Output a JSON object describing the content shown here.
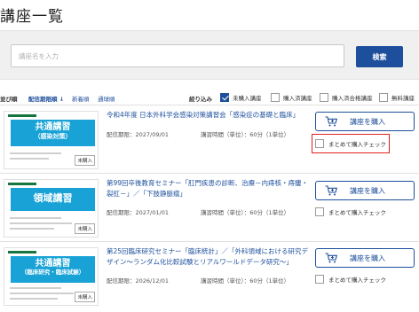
{
  "page": {
    "title": "講座一覧"
  },
  "search": {
    "placeholder": "講座名を入力",
    "value": "",
    "button_label": "検索"
  },
  "sort": {
    "label": "並び順",
    "options": [
      {
        "label": "配信期限順 ↓",
        "active": true
      },
      {
        "label": "新着順",
        "active": false
      },
      {
        "label": "通球順",
        "active": false
      }
    ]
  },
  "filter": {
    "label": "絞り込み",
    "options": [
      {
        "label": "未購入講座",
        "checked": true
      },
      {
        "label": "購入済講座",
        "checked": false
      },
      {
        "label": "購入済合格講座",
        "checked": false
      },
      {
        "label": "無料講座",
        "checked": false
      }
    ]
  },
  "courses": [
    {
      "title": "令和4年度 日本外科学会感染対策講習会「感染症の基礎と臨床」",
      "deadline": "配信期限：2027/09/01",
      "hours": "講習時間（単位）：60分（1単位）",
      "buy_label": "講座を購入",
      "bulk_label": "まとめて購入チェック",
      "thumb": {
        "line1": "共通講習",
        "line2": "（感染対策）",
        "badge": "未購入"
      }
    },
    {
      "title": "第99回卒後教育セミナー「肛門疾患の診断、治療－内痔核・痔瘻・裂肛－」／「下肢静脈瘤」",
      "deadline": "配信期限：2027/01/01",
      "hours": "講習時間（単位）：60分（1単位）",
      "buy_label": "講座を購入",
      "bulk_label": "まとめて購入チェック",
      "thumb": {
        "line1": "領域講習",
        "line2": "",
        "badge": "未購入"
      }
    },
    {
      "title": "第25回臨床研究セミナー「臨床統計」／「外科領域における研究デザイン～ランダム化比較試験とリアルワールドデータ研究～」",
      "deadline": "配信期限：2026/12/01",
      "hours": "講習時間（単位）：60分（1単位）",
      "buy_label": "講座を購入",
      "bulk_label": "まとめて購入チェック",
      "thumb": {
        "line1": "共通講習",
        "line2": "（臨床研究・臨床試験）",
        "badge": "未購入"
      }
    }
  ],
  "colors": {
    "brand": "#1d4f9c",
    "thumb_banner": "#18a2d6",
    "highlight": "#e02020"
  },
  "icons": {
    "cart": "cart-plus-icon",
    "check": "checkbox-icon"
  }
}
